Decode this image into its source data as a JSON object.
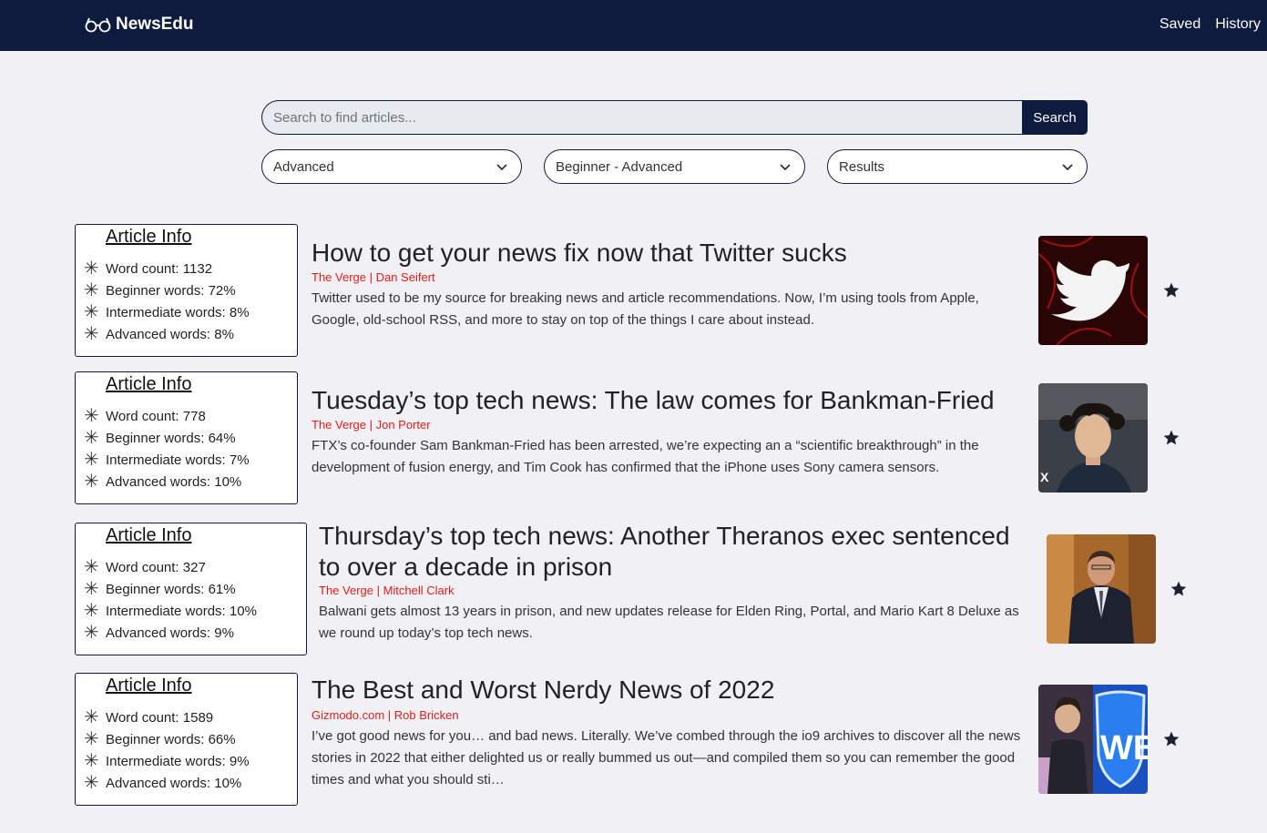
{
  "navbar": {
    "brand": "NewsEdu",
    "links": [
      "Saved",
      "History"
    ]
  },
  "search": {
    "placeholder": "Search to find articles...",
    "value": "",
    "button_label": "Search"
  },
  "filters": {
    "level": "Advanced",
    "range": "Beginner - Advanced",
    "sort": "Results"
  },
  "info_labels": {
    "title": "Article Info",
    "word_count": "Word count:",
    "beginner": "Beginner words:",
    "intermediate": "Intermediate words:",
    "advanced": "Advanced words:"
  },
  "articles": [
    {
      "title": "How to get your news fix now that Twitter sucks",
      "source": "The Verge | Dan Seifert",
      "description": "Twitter used to be my source for breaking news and article recommendations. Now, I’m using tools from Apple, Google, old-school RSS, and more to stay on top of the things I care about instead.",
      "word_count": "1132",
      "beginner": "72%",
      "intermediate": "8%",
      "advanced": "8%",
      "thumbnail_icon": "twitter-bird-image"
    },
    {
      "title": "Tuesday’s top tech news: The law comes for Bankman-Fried",
      "source": "The Verge | Jon Porter",
      "description": "FTX’s co-founder Sam Bankman-Fried has been arrested, we’re expecting an a “scientific breakthrough” in the development of fusion energy, and Tim Cook has confirmed that the iPhone uses Sony camera sensors.",
      "word_count": "778",
      "beginner": "64%",
      "intermediate": "7%",
      "advanced": "10%",
      "thumbnail_icon": "person-portrait-image"
    },
    {
      "title": "Thursday’s top tech news: Another Theranos exec sentenced to over a decade in prison",
      "source": "The Verge | Mitchell Clark",
      "description": "Balwani gets almost 13 years in prison, and new updates release for Elden Ring, Portal, and Mario Kart 8 Deluxe as we round up today’s top tech news.",
      "word_count": "327",
      "beginner": "61%",
      "intermediate": "10%",
      "advanced": "9%",
      "thumbnail_icon": "person-in-suit-image"
    },
    {
      "title": "The Best and Worst Nerdy News of 2022",
      "source": "Gizmodo.com | Rob Bricken",
      "description": "I’ve got good news for you… and bad news. Literally. We’ve combed through the io9 archives to discover all the news stories in 2022 that either delighted us or really bummed us out—and compiled them so you can remember the good times and what you should sti…",
      "word_count": "1589",
      "beginner": "66%",
      "intermediate": "9%",
      "advanced": "10%",
      "thumbnail_icon": "wb-logo-collage-image"
    }
  ],
  "colors": {
    "navbar": "#0e1a3e",
    "background": "#f1f1f5",
    "source": "#e01b1b"
  }
}
